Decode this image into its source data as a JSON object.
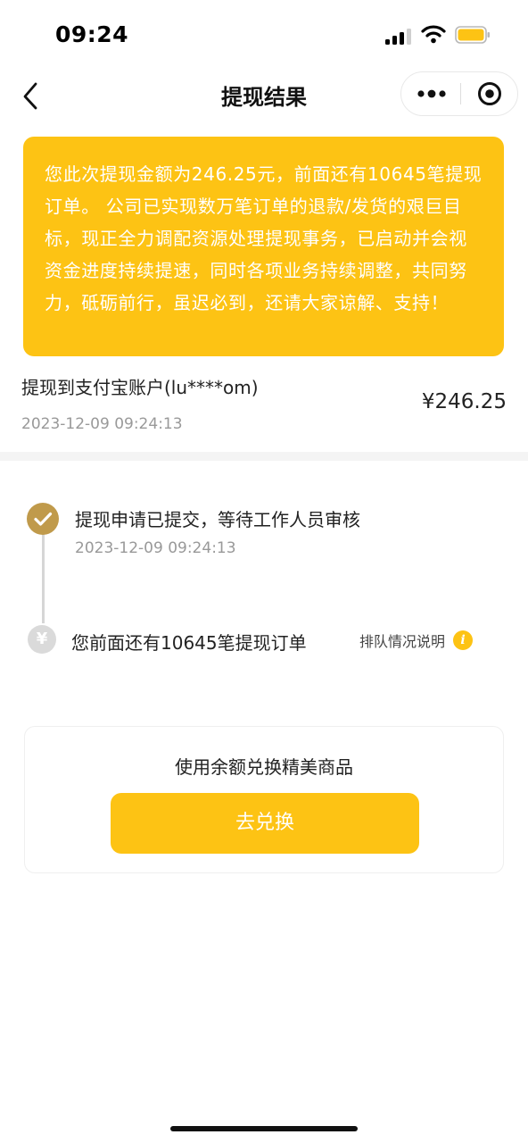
{
  "status_bar": {
    "time": "09:24"
  },
  "nav": {
    "title": "提现结果"
  },
  "notice": {
    "text": "您此次提现金额为246.25元，前面还有10645笔提现订单。 公司已实现数万笔订单的退款/发货的艰巨目标，现正全力调配资源处理提现事务，已启动并会视资金进度持续提速，同时各项业务持续调整，共同努力，砥砺前行，虽迟必到，还请大家谅解、支持！"
  },
  "withdraw": {
    "destination": "提现到支付宝账户(lu****om)",
    "amount": "¥246.25",
    "time": "2023-12-09 09:24:13"
  },
  "timeline": {
    "steps": [
      {
        "title": "提现申请已提交，等待工作人员审核",
        "time": "2023-12-09 09:24:13",
        "status": "done",
        "icon": "check-icon"
      },
      {
        "title": "您前面还有10645笔提现订单",
        "status": "waiting",
        "icon": "yen-icon",
        "icon_glyph": "¥"
      }
    ],
    "queue_link": "排队情况说明",
    "info_glyph": "i"
  },
  "exchange": {
    "title": "使用余额兑换精美商品",
    "button": "去兑换"
  },
  "colors": {
    "accent": "#fdc314",
    "done": "#c09a4b",
    "pending": "#dadada"
  }
}
